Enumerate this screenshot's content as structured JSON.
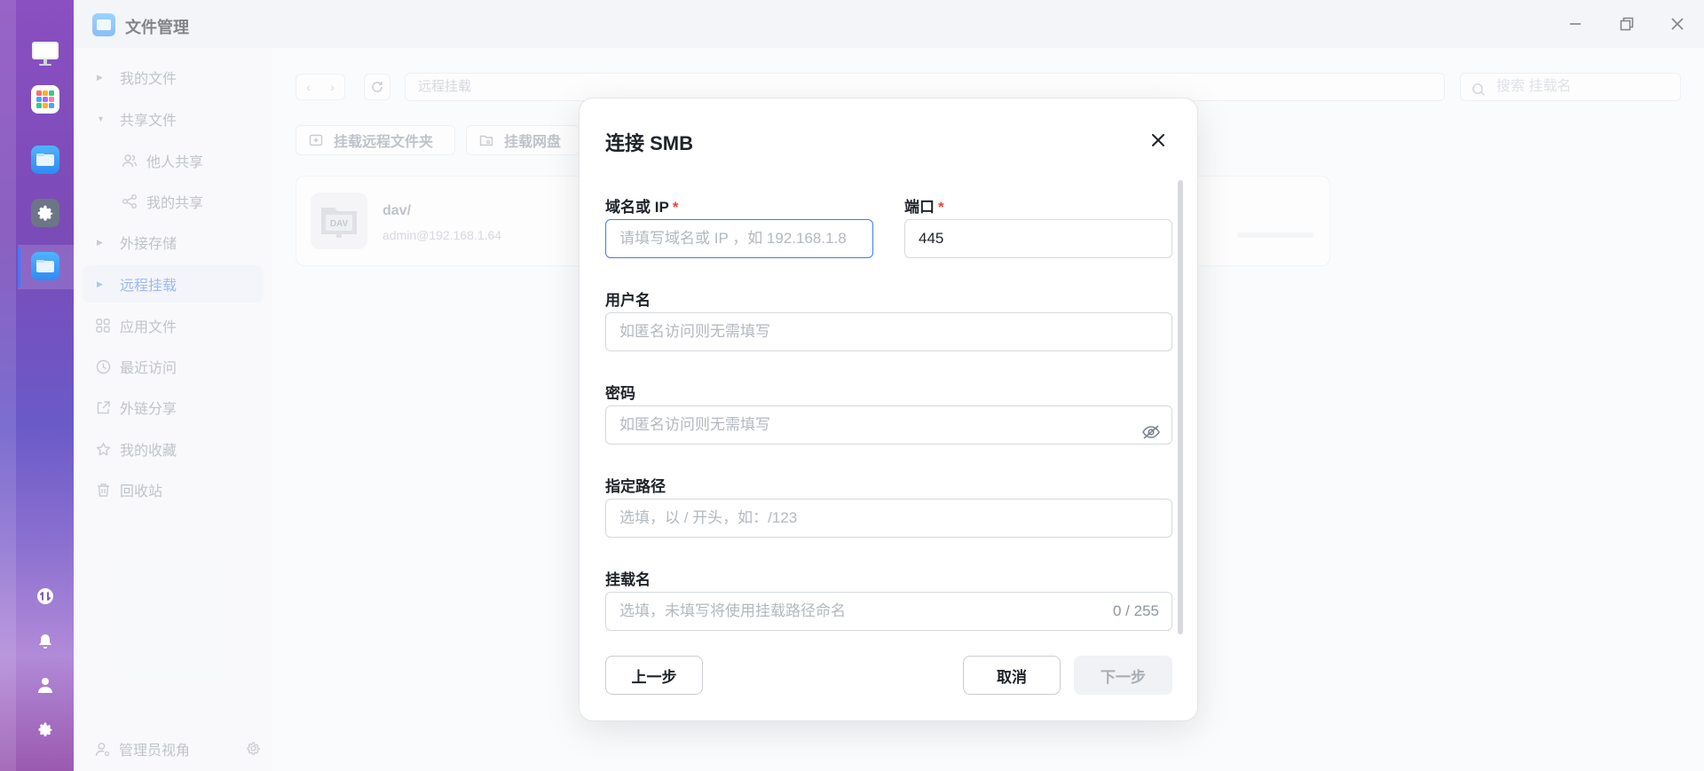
{
  "app": {
    "title": "文件管理"
  },
  "sidebar": {
    "items": [
      {
        "label": "我的文件",
        "kind": "expandable"
      },
      {
        "label": "共享文件",
        "kind": "expanded"
      },
      {
        "label": "他人共享",
        "kind": "sub",
        "icon": "users-icon"
      },
      {
        "label": "我的共享",
        "kind": "sub",
        "icon": "share-icon"
      },
      {
        "label": "外接存储",
        "kind": "expandable"
      },
      {
        "label": "远程挂载",
        "kind": "expandable",
        "active": true
      },
      {
        "label": "应用文件",
        "icon": "apps-icon"
      },
      {
        "label": "最近访问",
        "icon": "clock-icon"
      },
      {
        "label": "外链分享",
        "icon": "external-link-icon"
      },
      {
        "label": "我的收藏",
        "icon": "star-icon"
      },
      {
        "label": "回收站",
        "icon": "trash-icon"
      }
    ],
    "footer_label": "管理员视角"
  },
  "main": {
    "path": "远程挂载",
    "search_placeholder": "搜索 挂载名",
    "toolbar": {
      "mount_remote_folder": "挂载远程文件夹",
      "mount_cloud_drive": "挂载网盘"
    },
    "mounts": [
      {
        "name": "dav/",
        "address": "admin@192.168.1.64",
        "badge": "DAV"
      }
    ]
  },
  "dialog": {
    "title": "连接 SMB",
    "host": {
      "label": "域名或 IP",
      "required_mark": "*",
      "placeholder": "请填写域名或 IP ，如 192.168.1.8"
    },
    "port": {
      "label": "端口",
      "required_mark": "*",
      "value": "445"
    },
    "username": {
      "label": "用户名",
      "placeholder": "如匿名访问则无需填写"
    },
    "password": {
      "label": "密码",
      "placeholder": "如匿名访问则无需填写"
    },
    "path": {
      "label": "指定路径",
      "placeholder": "选填，以 / 开头，如：/123"
    },
    "mount_name": {
      "label": "挂载名",
      "placeholder": "选填，未填写将使用挂载路径命名",
      "counter": "0 / 255"
    },
    "buttons": {
      "prev": "上一步",
      "cancel": "取消",
      "next": "下一步"
    }
  },
  "colors": {
    "accent": "#3d7bff",
    "required": "#f04438",
    "dock_top": "#8a4fc0",
    "dock_bottom": "#9a5ab0"
  }
}
